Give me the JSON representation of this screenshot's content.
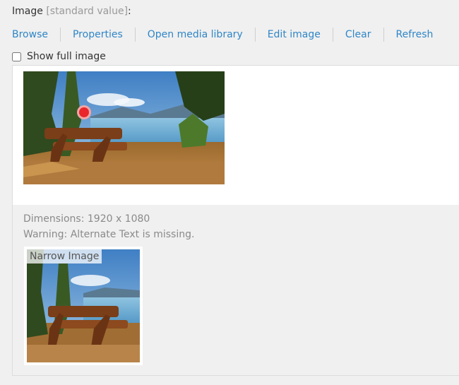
{
  "field": {
    "label": "Image",
    "std_value": "[standard value]",
    "colon": ":"
  },
  "toolbar": {
    "browse": "Browse",
    "properties": "Properties",
    "open_media_library": "Open media library",
    "edit_image": "Edit image",
    "clear": "Clear",
    "refresh": "Refresh"
  },
  "show_full_image": {
    "label": "Show full image",
    "checked": false
  },
  "info": {
    "dimensions": "Dimensions: 1920 x 1080",
    "warning": "Warning: Alternate Text is missing."
  },
  "thumbnail": {
    "caption": "Narrow Image"
  },
  "colors": {
    "link": "#2f86c7",
    "focus_marker": "#e8262b"
  }
}
